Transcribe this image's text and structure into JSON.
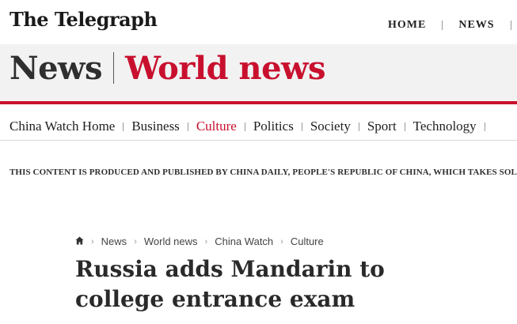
{
  "header": {
    "logo_text": "The Telegraph",
    "nav": [
      "HOME",
      "NEWS"
    ]
  },
  "section": {
    "name": "News",
    "subsection": "World news"
  },
  "subnav": {
    "items": [
      {
        "label": "China Watch Home",
        "active": false
      },
      {
        "label": "Business",
        "active": false
      },
      {
        "label": "Culture",
        "active": true
      },
      {
        "label": "Politics",
        "active": false
      },
      {
        "label": "Society",
        "active": false
      },
      {
        "label": "Sport",
        "active": false
      },
      {
        "label": "Technology",
        "active": false
      }
    ]
  },
  "disclaimer": "THIS CONTENT IS PRODUCED AND PUBLISHED BY CHINA DAILY, PEOPLE'S REPUBLIC OF CHINA, WHICH TAKES SOLE RESPONSIBILITY FOR IT",
  "breadcrumb": {
    "home_icon": "home-icon",
    "items": [
      "News",
      "World news",
      "China Watch",
      "Culture"
    ]
  },
  "article": {
    "headline": "Russia adds Mandarin to college entrance exam"
  },
  "colors": {
    "accent": "#c8102e",
    "text": "#1f1f1f",
    "band": "#f2f2f2"
  }
}
